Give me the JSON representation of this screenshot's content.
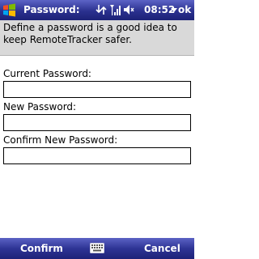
{
  "titlebar": {
    "title": "Password:",
    "clock": "08:52",
    "ok_label": "ok",
    "icons": [
      "windows-start-icon",
      "connectivity-icon",
      "signal-icon",
      "volume-icon",
      "chevron-down-icon"
    ]
  },
  "description": "Define a password is a good idea to keep RemoteTracker safer.",
  "form": {
    "current_label": "Current Password:",
    "current_value": "",
    "new_label": "New Password:",
    "new_value": "",
    "confirm_label": "Confirm New Password:",
    "confirm_value": ""
  },
  "softkeys": {
    "left": "Confirm",
    "right": "Cancel",
    "center_icon": "keyboard-icon"
  },
  "colors": {
    "bar_top": "#5c63c6",
    "bar_bottom": "#1c2176",
    "description_bg": "#d9d9d9"
  }
}
